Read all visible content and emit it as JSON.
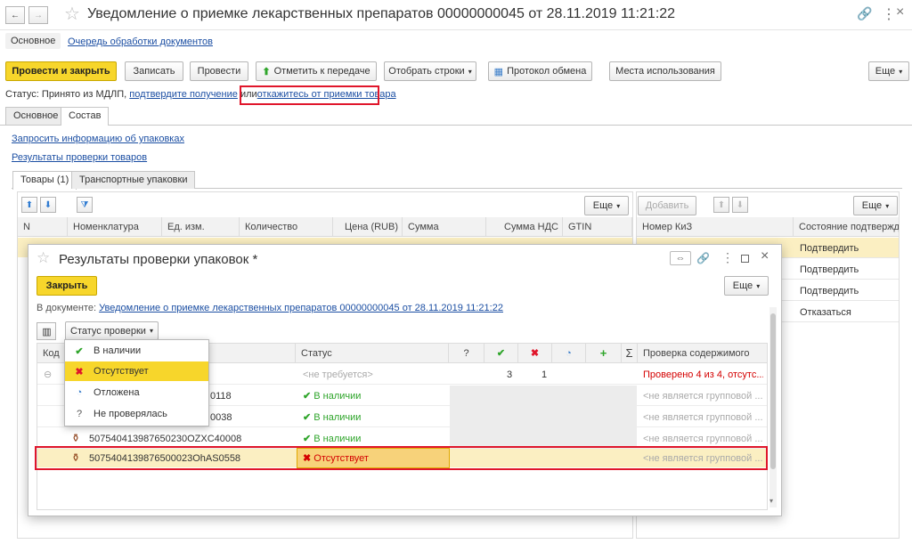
{
  "window": {
    "title": "Уведомление о приемке лекарственных препаратов 00000000045 от 28.11.2019 11:21:22",
    "nav_links": [
      "Основное",
      "Очередь обработки документов"
    ]
  },
  "toolbar": {
    "post_close": "Провести и закрыть",
    "save": "Записать",
    "post": "Провести",
    "mark_transfer": "Отметить к передаче",
    "select_rows": "Отобрать строки",
    "exchange_log": "Протокол обмена",
    "usage_places": "Места использования",
    "more": "Еще"
  },
  "status": {
    "prefix": "Статус:",
    "text": "Принято из МДЛП,",
    "confirm_link": "подтвердите получение",
    "or": "или",
    "refuse_link": "откажитесь от приемки товара"
  },
  "tabs": [
    "Основное",
    "Состав"
  ],
  "composition": {
    "link_request": "Запросить информацию об упаковках",
    "link_results": "Результаты проверки товаров",
    "subtabs": [
      "Товары (1)",
      "Транспортные упаковки"
    ],
    "more": "Еще",
    "add": "Добавить",
    "columns": [
      "N",
      "Номенклатура",
      "Ед. изм.",
      "Количество",
      "Цена (RUB)",
      "Сумма",
      "Сумма НДС",
      "GTIN"
    ],
    "kiz_columns": [
      "Номер КиЗ",
      "Состояние подтвержде"
    ],
    "kiz_states": [
      "Подтвердить",
      "Подтвердить",
      "Подтвердить",
      "Отказаться"
    ]
  },
  "dialog": {
    "title": "Результаты проверки упаковок *",
    "close_btn": "Закрыть",
    "more": "Еще",
    "doc_label": "В документе:",
    "doc_link": "Уведомление о приемке лекарственных препаратов 00000000045 от 28.11.2019 11:21:22",
    "filter_label": "Статус проверки",
    "columns": [
      "Код",
      "Статус",
      "?",
      "Проверка содержимого"
    ],
    "rows": [
      {
        "code": "",
        "status": "<не требуется>",
        "count_ok": "3",
        "count_missing": "1",
        "content": "Проверено 4 из 4, отсутс..."
      },
      {
        "code": "0118",
        "status": "В наличии",
        "content": "<не является групповой ..."
      },
      {
        "code": "0038",
        "status": "В наличии",
        "content": "<не является групповой ..."
      },
      {
        "code": "507540413987650230ОZXC40008",
        "status": "В наличии",
        "content": "<не является групповой ..."
      },
      {
        "code": "5075404139876500023ОhAS0558",
        "status": "Отсутствует",
        "content": "<не является групповой ..."
      }
    ]
  },
  "dropdown": {
    "items": [
      "В наличии",
      "Отсутствует",
      "Отложена",
      "Не проверялась"
    ]
  },
  "colors": {
    "accent": "#f7d62b",
    "highlight": "#e0162b",
    "link": "#1c4fa3"
  }
}
